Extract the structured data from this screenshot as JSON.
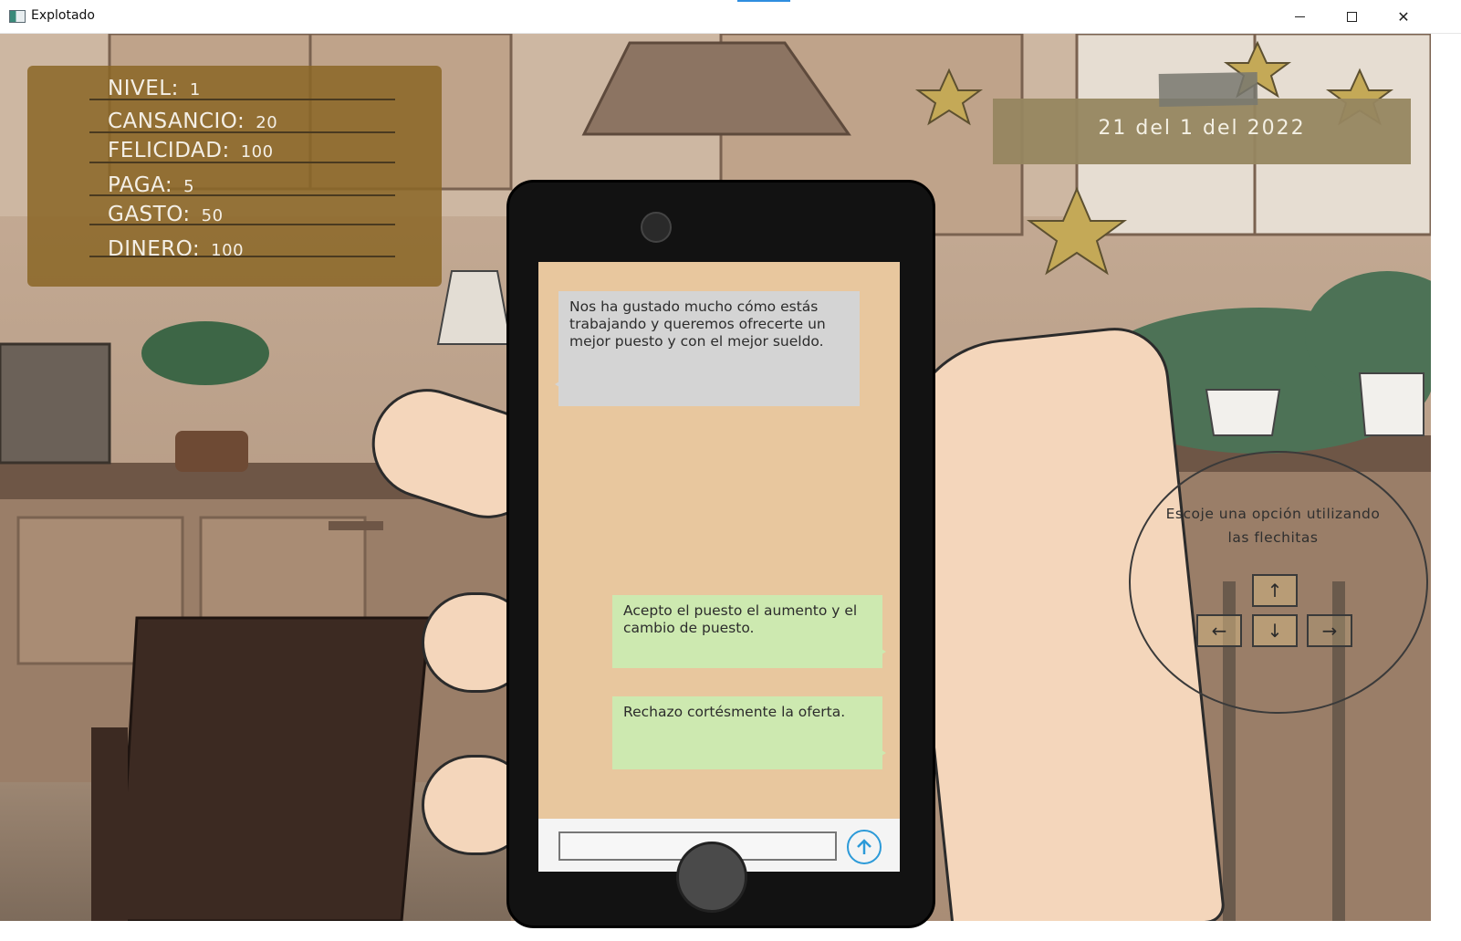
{
  "window": {
    "title": "Explotado",
    "minimize_icon": "minimize-icon",
    "maximize_icon": "maximize-icon",
    "close_icon": "close-icon",
    "close_glyph": "✕"
  },
  "hud": {
    "stats": [
      {
        "label": "NIVEL:",
        "value": "1"
      },
      {
        "label": "CANSANCIO:",
        "value": "20"
      },
      {
        "label": "FELICIDAD:",
        "value": "100"
      },
      {
        "label": "PAGA:",
        "value": "5"
      },
      {
        "label": "GASTO:",
        "value": "50"
      },
      {
        "label": "DINERO:",
        "value": "100"
      }
    ],
    "date": "21 del 1 del 2022"
  },
  "phone": {
    "incoming_message": "Nos ha gustado mucho cómo estás trabajando y queremos ofrecerte un mejor puesto y con el mejor sueldo.",
    "options": [
      "Acepto el puesto el aumento y el cambio de puesto.",
      "Rechazo cortésmente la oferta."
    ],
    "input_value": "",
    "send_icon": "arrow-up-icon"
  },
  "hint": {
    "text": "Escoje una opción utilizando las flechitas",
    "keys": {
      "up": "↑",
      "left": "←",
      "down": "↓",
      "right": "→"
    }
  },
  "colors": {
    "stats_panel": "#8b6626",
    "date_tag": "#968660",
    "screen_bg": "#e8c79e",
    "incoming_bubble": "#d4d4d4",
    "option_bubble": "#cde9b0",
    "send_accent": "#2c9ad8"
  }
}
